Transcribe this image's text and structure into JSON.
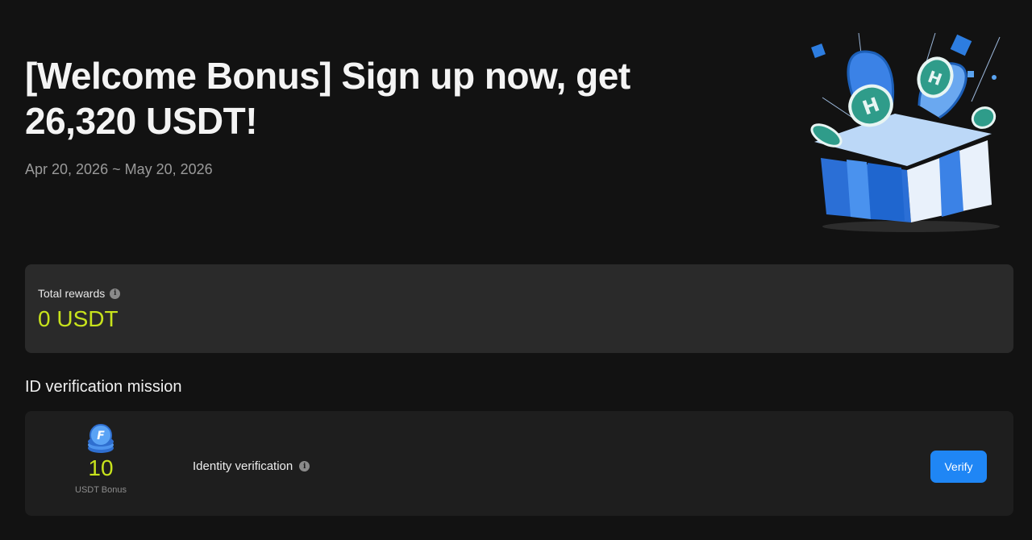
{
  "hero": {
    "title": "[Welcome Bonus] Sign up now, get 26,320 USDT!",
    "dates": "Apr 20, 2026 ~ May 20, 2026",
    "illustration": "gift-box-with-coins-illustration"
  },
  "rewards": {
    "label": "Total rewards",
    "info_icon": "i",
    "value": "0 USDT"
  },
  "mission": {
    "heading": "ID verification mission",
    "item": {
      "bonus_amount": "10",
      "bonus_unit": "USDT Bonus",
      "coin_icon": "coin-stack-icon",
      "title": "Identity verification",
      "info_icon": "i",
      "action_label": "Verify"
    }
  },
  "colors": {
    "background": "#121212",
    "accent_green": "#c8e31c",
    "button_blue": "#1f86f5"
  }
}
